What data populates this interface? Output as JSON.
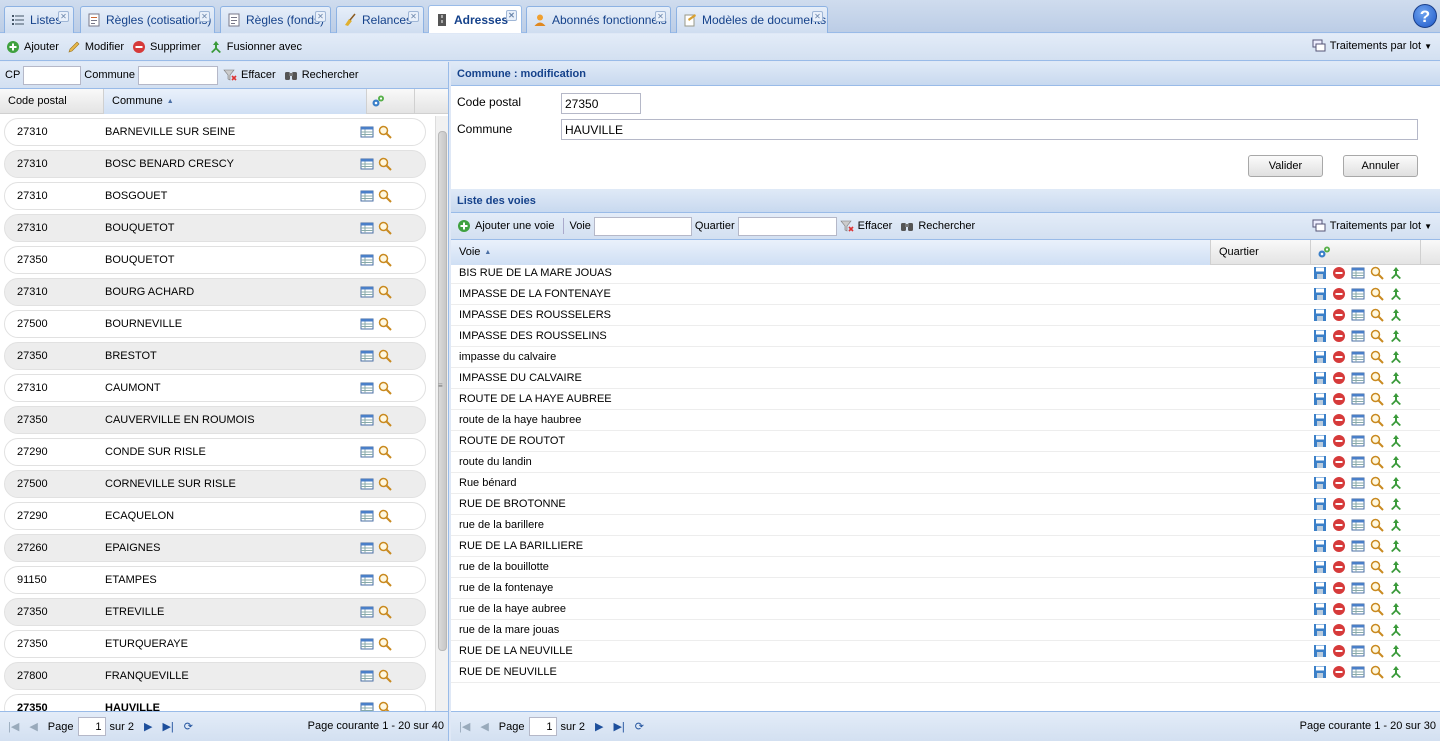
{
  "tabs": [
    {
      "label": "Listes",
      "icon": "list-icon"
    },
    {
      "label": "Règles (cotisations)",
      "icon": "rules-icon"
    },
    {
      "label": "Règles (fonds)",
      "icon": "rules-icon"
    },
    {
      "label": "Relances",
      "icon": "broom-icon"
    },
    {
      "label": "Adresses",
      "icon": "road-icon"
    },
    {
      "label": "Abonnés fonctionnels",
      "icon": "user-icon"
    },
    {
      "label": "Modèles de documents",
      "icon": "document-icon"
    }
  ],
  "help_label": "?",
  "toolbar": {
    "add": "Ajouter",
    "edit": "Modifier",
    "delete": "Supprimer",
    "merge": "Fusionner avec",
    "batch": "Traitements par lot"
  },
  "left_search": {
    "cp_label": "CP",
    "cp_value": "",
    "commune_label": "Commune",
    "commune_value": "",
    "clear": "Effacer",
    "search": "Rechercher"
  },
  "left_grid": {
    "col_cp": "Code postal",
    "col_commune": "Commune",
    "rows": [
      {
        "cp": "27310",
        "commune": "BARNEVILLE SUR SEINE"
      },
      {
        "cp": "27310",
        "commune": "BOSC BENARD CRESCY"
      },
      {
        "cp": "27310",
        "commune": "BOSGOUET"
      },
      {
        "cp": "27310",
        "commune": "BOUQUETOT"
      },
      {
        "cp": "27350",
        "commune": "BOUQUETOT"
      },
      {
        "cp": "27310",
        "commune": "BOURG ACHARD"
      },
      {
        "cp": "27500",
        "commune": "BOURNEVILLE"
      },
      {
        "cp": "27350",
        "commune": "BRESTOT"
      },
      {
        "cp": "27310",
        "commune": "CAUMONT"
      },
      {
        "cp": "27350",
        "commune": "CAUVERVILLE EN ROUMOIS"
      },
      {
        "cp": "27290",
        "commune": "CONDE SUR RISLE"
      },
      {
        "cp": "27500",
        "commune": "CORNEVILLE SUR RISLE"
      },
      {
        "cp": "27290",
        "commune": "ECAQUELON"
      },
      {
        "cp": "27260",
        "commune": "EPAIGNES"
      },
      {
        "cp": "91150",
        "commune": "ETAMPES"
      },
      {
        "cp": "27350",
        "commune": "ETREVILLE"
      },
      {
        "cp": "27350",
        "commune": "ETURQUERAYE"
      },
      {
        "cp": "27800",
        "commune": "FRANQUEVILLE"
      },
      {
        "cp": "27350",
        "commune": "HAUVILLE"
      }
    ]
  },
  "left_pager": {
    "page_label": "Page",
    "page": "1",
    "of": "sur 2",
    "info": "Page courante 1 - 20 sur 40"
  },
  "edit_panel": {
    "title": "Commune : modification",
    "cp_label": "Code postal",
    "cp_value": "27350",
    "commune_label": "Commune",
    "commune_value": "HAUVILLE",
    "validate": "Valider",
    "cancel": "Annuler"
  },
  "voies_panel": {
    "title": "Liste des voies",
    "add": "Ajouter une voie",
    "voie_label": "Voie",
    "voie_value": "",
    "quartier_label": "Quartier",
    "quartier_value": "",
    "clear": "Effacer",
    "search": "Rechercher",
    "batch": "Traitements par lot",
    "col_voie": "Voie",
    "col_quartier": "Quartier",
    "rows": [
      "BIS RUE DE LA MARE JOUAS",
      "IMPASSE DE LA FONTENAYE",
      "IMPASSE DES ROUSSELERS",
      "IMPASSE DES ROUSSELINS",
      "impasse du calvaire",
      "IMPASSE DU CALVAIRE",
      "ROUTE DE LA HAYE AUBREE",
      "route de la haye haubree",
      "ROUTE DE ROUTOT",
      "route du landin",
      "Rue bénard",
      "RUE DE BROTONNE",
      "rue de la barillere",
      "RUE DE LA BARILLIERE",
      "rue de la bouillotte",
      "rue de la fontenaye",
      "rue de la haye aubree",
      "rue de la mare jouas",
      "RUE DE LA NEUVILLE",
      "RUE DE NEUVILLE"
    ]
  },
  "right_pager": {
    "page_label": "Page",
    "page": "1",
    "of": "sur 2",
    "info": "Page courante 1 - 20 sur 30"
  }
}
